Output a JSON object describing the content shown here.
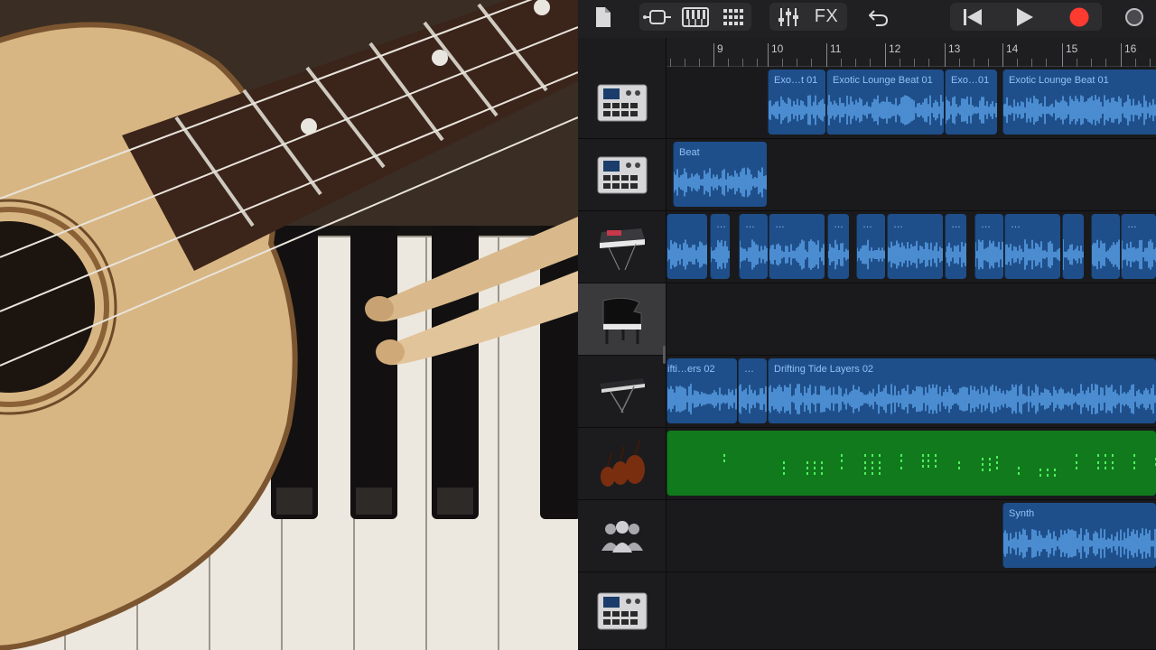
{
  "photo": {
    "description_name": "ukulele-piano-drumsticks-photo"
  },
  "toolbar": {
    "fx_label": "FX",
    "icons": [
      "document-icon",
      "tracks-view-icon",
      "keyboard-icon",
      "grid-icon",
      "mixer-icon",
      "undo-icon",
      "go-to-start-icon",
      "play-icon",
      "record-icon",
      "metronome-icon"
    ],
    "record_color": "#ff3b30"
  },
  "ruler": {
    "bars": [
      "9",
      "10",
      "11",
      "12",
      "13",
      "14",
      "15",
      "16"
    ]
  },
  "tracks": [
    {
      "instrument": "drum-machine-icon",
      "regions": [
        {
          "label": "Exo…t 01"
        },
        {
          "label": "Exotic Lounge Beat 01"
        },
        {
          "label": "Exo…01"
        },
        {
          "label": "Exotic Lounge Beat 01"
        }
      ]
    },
    {
      "instrument": "drum-machine-icon",
      "regions": [
        {
          "label": "Beat"
        }
      ]
    },
    {
      "instrument": "synth-keyboard-icon",
      "regions": [
        {
          "label": "…"
        },
        {
          "label": "…"
        },
        {
          "label": "…"
        },
        {
          "label": "…"
        },
        {
          "label": "…"
        },
        {
          "label": "…"
        },
        {
          "label": "…"
        },
        {
          "label": "…"
        },
        {
          "label": "…"
        },
        {
          "label": "…"
        }
      ]
    },
    {
      "instrument": "grand-piano-icon",
      "selected": true,
      "regions": []
    },
    {
      "instrument": "stage-keyboard-icon",
      "regions": [
        {
          "label": "ifti…ers 02"
        },
        {
          "label": "…"
        },
        {
          "label": "Drifting Tide Layers 02"
        }
      ]
    },
    {
      "instrument": "strings-icon",
      "regions": [
        {
          "label": ""
        }
      ]
    },
    {
      "instrument": "audio-recorder-icon",
      "regions": [
        {
          "label": "Synth"
        }
      ]
    },
    {
      "instrument": "drum-machine-icon",
      "regions": []
    }
  ],
  "colors": {
    "region_blue": "#1f4f8a",
    "region_label": "#8fc0f5",
    "midi_green": "#117a1d",
    "note_green": "#4ef05a"
  }
}
